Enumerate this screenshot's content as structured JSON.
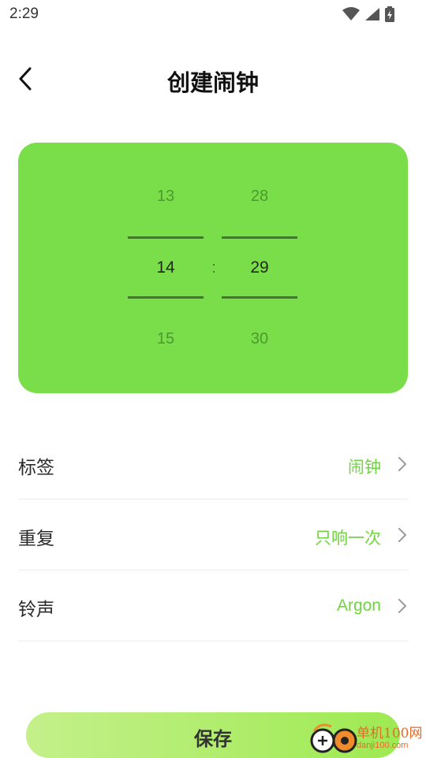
{
  "status_bar": {
    "time": "2:29",
    "icons": [
      "wifi-icon",
      "cell-signal-icon",
      "battery-charging-icon"
    ]
  },
  "header": {
    "back_icon": "back-chevron-icon",
    "title": "创建闹钟"
  },
  "time_picker": {
    "separator": ":",
    "hours": {
      "prev": "13",
      "current": "14",
      "next": "15"
    },
    "minutes": {
      "prev": "28",
      "current": "29",
      "next": "30"
    },
    "background_color": "#7ade4a"
  },
  "settings": [
    {
      "label": "标签",
      "value": "闹钟"
    },
    {
      "label": "重复",
      "value": "只响一次"
    },
    {
      "label": "铃声",
      "value": "Argon"
    }
  ],
  "save_label": "保存",
  "watermark": {
    "text": "单机100网",
    "sub": "danji100.com"
  },
  "colors": {
    "accent": "#6ed43f",
    "card": "#7ade4a"
  }
}
